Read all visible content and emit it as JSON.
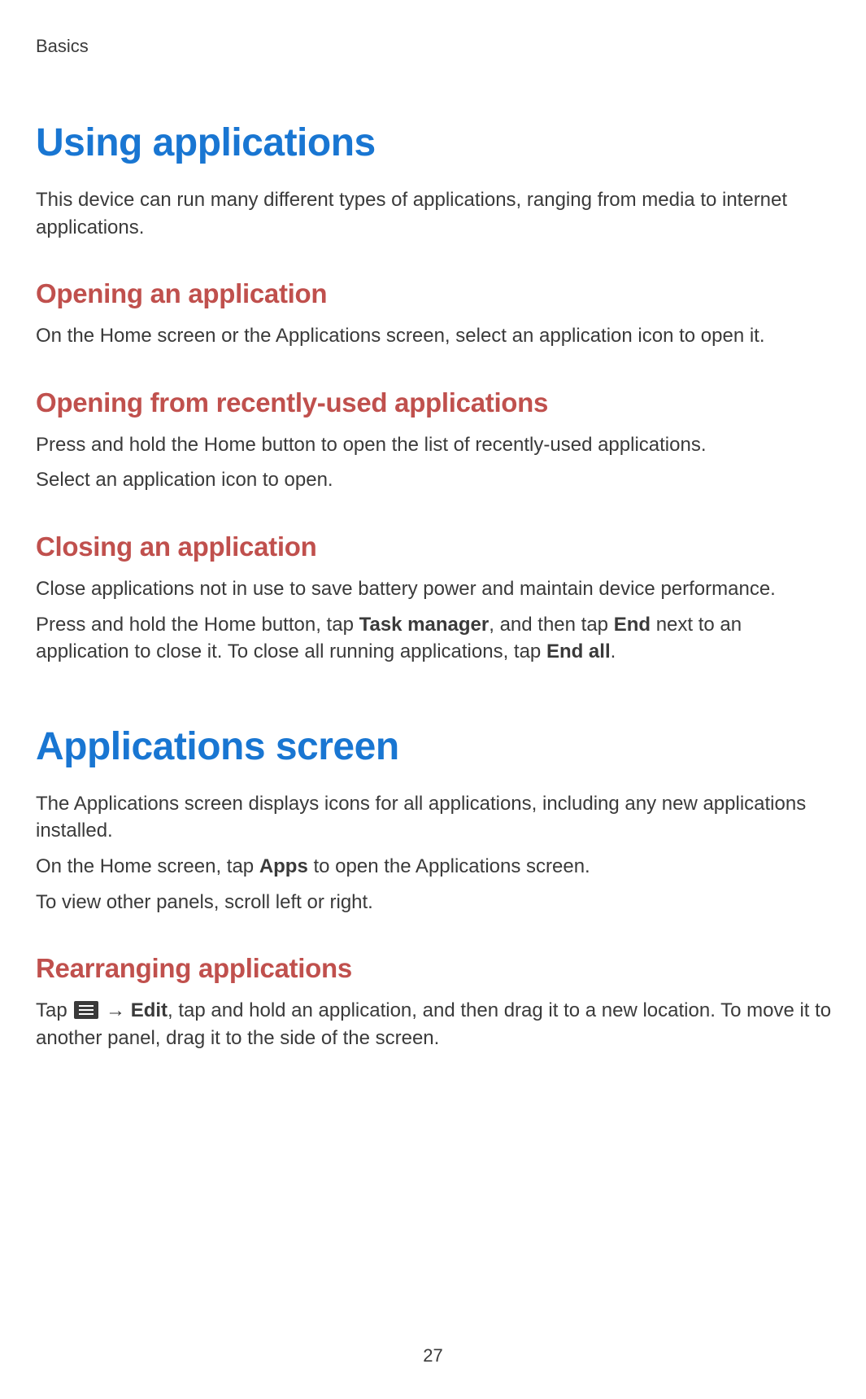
{
  "breadcrumb": "Basics",
  "page_number": "27",
  "sections": {
    "using_apps": {
      "title": "Using applications",
      "intro": "This device can run many different types of applications, ranging from media to internet applications.",
      "opening": {
        "heading": "Opening an application",
        "body": "On the Home screen or the Applications screen, select an application icon to open it."
      },
      "recent": {
        "heading": "Opening from recently-used applications",
        "line1": "Press and hold the Home button to open the list of recently-used applications.",
        "line2": "Select an application icon to open."
      },
      "closing": {
        "heading": "Closing an application",
        "line1": "Close applications not in use to save battery power and maintain device performance.",
        "line2_pre": "Press and hold the Home button, tap ",
        "line2_b1": "Task manager",
        "line2_mid": ", and then tap ",
        "line2_b2": "End",
        "line2_post": " next to an application to close it. To close all running applications, tap ",
        "line2_b3": "End all",
        "line2_end": "."
      }
    },
    "apps_screen": {
      "title": "Applications screen",
      "intro": "The Applications screen displays icons for all applications, including any new applications installed.",
      "line2_pre": "On the Home screen, tap ",
      "line2_b1": "Apps",
      "line2_post": " to open the Applications screen.",
      "line3": "To view other panels, scroll left or right.",
      "rearranging": {
        "heading": "Rearranging applications",
        "pre": "Tap ",
        "arrow": " → ",
        "b1": "Edit",
        "post": ", tap and hold an application, and then drag it to a new location. To move it to another panel, drag it to the side of the screen."
      }
    }
  }
}
